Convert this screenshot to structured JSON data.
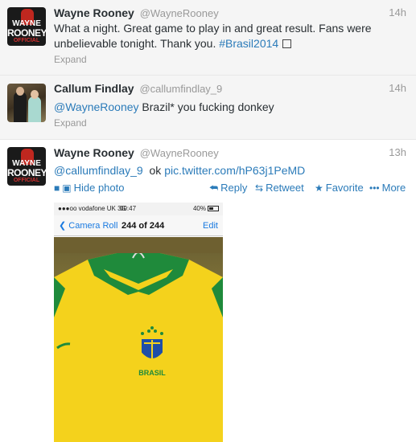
{
  "tweets": [
    {
      "name": "Wayne Rooney",
      "handle": "@WayneRooney",
      "time": "14h",
      "text_plain": "What a night. Great game to play in and great result. Fans were unbelievable tonight. Thank you. ",
      "hashtag": "#Brasil2014",
      "expand": "Expand",
      "avatar_text": {
        "line1": "WAYNE",
        "line2": "ROONEY",
        "line3": "OFFICIAL"
      }
    },
    {
      "name": "Callum Findlay",
      "handle": "@callumfindlay_9",
      "time": "14h",
      "mention": "@WayneRooney",
      "text_plain": " Brazil* you fucking donkey",
      "expand": "Expand"
    },
    {
      "name": "Wayne Rooney",
      "handle": "@WayneRooney",
      "time": "13h",
      "mention": "@callumfindlay_9",
      "text_plain": "  ok ",
      "pic_link": "pic.twitter.com/hP63j1PeMD",
      "avatar_text": {
        "line1": "WAYNE",
        "line2": "ROONEY",
        "line3": "OFFICIAL"
      },
      "actions": {
        "hide_photo": "Hide photo",
        "reply": "Reply",
        "retweet": "Retweet",
        "favorite": "Favorite",
        "more": "More"
      },
      "photo": {
        "carrier": "●●●oo vodafone UK  3G",
        "clock": "00:47",
        "battery": "40%",
        "back_label": "Camera Roll",
        "count": "244 of 244",
        "edit_label": "Edit",
        "shirt_text": "BRASIL"
      }
    }
  ],
  "colors": {
    "link": "#2b7bb9",
    "shirt_yellow": "#f4d21c",
    "shirt_green": "#1f8a3b"
  }
}
